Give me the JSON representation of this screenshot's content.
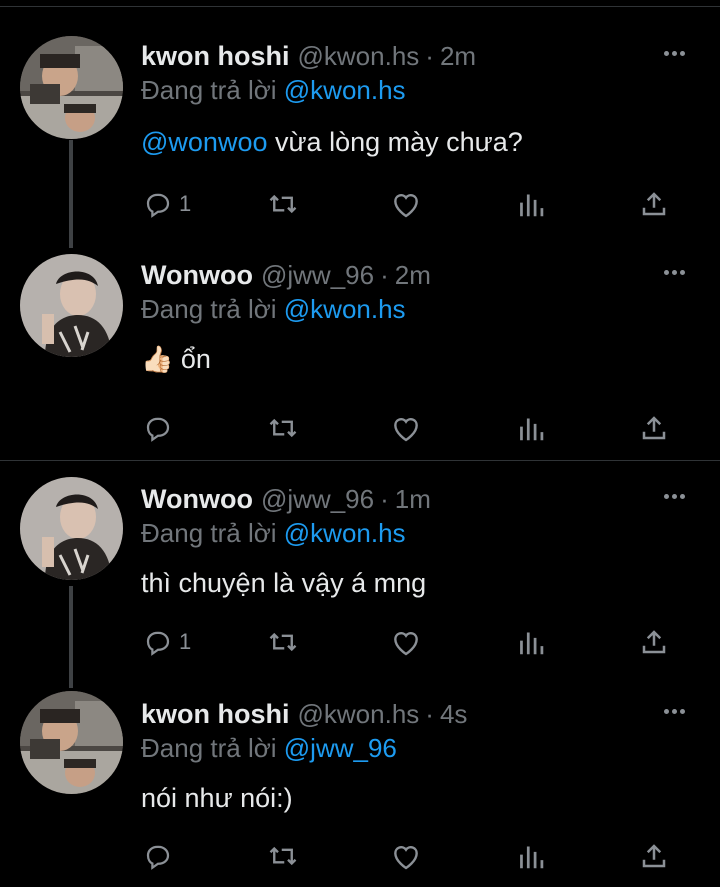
{
  "tweets": [
    {
      "name": "kwon hoshi",
      "handle": "@kwon.hs",
      "separator": "·",
      "time": "2m",
      "replying_prefix": "Đang trả lời ",
      "replying_to": "@kwon.hs",
      "body_mention": "@wonwoo",
      "body_text": " vừa lòng mày chưa?",
      "reply_count": "1",
      "avatar": "hoshi-avatar"
    },
    {
      "name": "Wonwoo",
      "handle": "@jww_96",
      "separator": "·",
      "time": "2m",
      "replying_prefix": "Đang trả lời ",
      "replying_to": "@kwon.hs",
      "body_emoji": "👍🏻",
      "body_text": " ổn",
      "reply_count": "",
      "avatar": "wonwoo-avatar"
    },
    {
      "name": "Wonwoo",
      "handle": "@jww_96",
      "separator": "·",
      "time": "1m",
      "replying_prefix": "Đang trả lời ",
      "replying_to": "@kwon.hs",
      "body_text": "thì chuyện là vậy á mng",
      "reply_count": "1",
      "avatar": "wonwoo-avatar"
    },
    {
      "name": "kwon hoshi",
      "handle": "@kwon.hs",
      "separator": "·",
      "time": "4s",
      "replying_prefix": "Đang trả lời ",
      "replying_to": "@jww_96",
      "body_text": "nói như nói:)",
      "reply_count": "",
      "avatar": "hoshi-avatar"
    }
  ],
  "colors": {
    "background": "#000000",
    "text": "#e7e9ea",
    "secondary": "#71767b",
    "accent": "#1d9bf0",
    "divider": "#2f3336"
  }
}
